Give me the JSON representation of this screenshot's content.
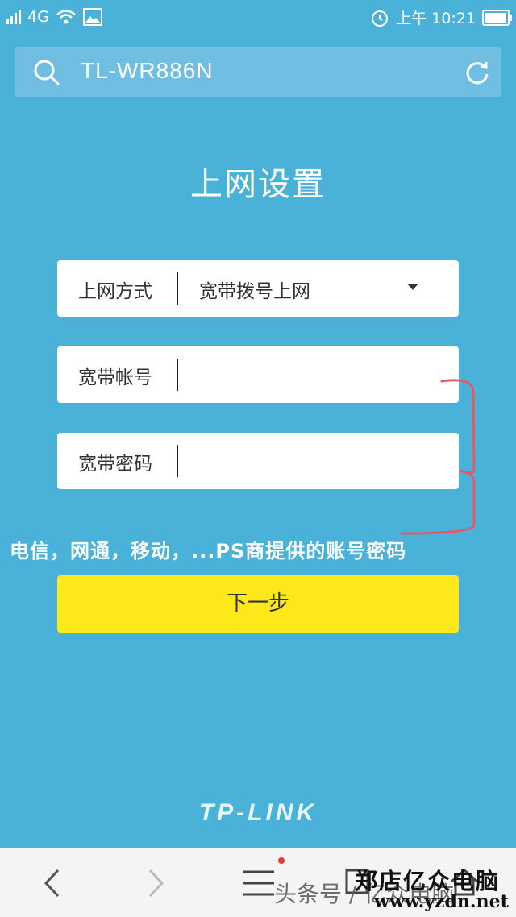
{
  "status_bar": {
    "network": "4G",
    "time": "上午 10:21"
  },
  "browser": {
    "address": "TL-WR886N"
  },
  "page": {
    "title": "上网设置",
    "fields": [
      {
        "label": "上网方式",
        "value": "宽带拨号上网"
      },
      {
        "label": "宽带帐号",
        "value": ""
      },
      {
        "label": "宽带密码",
        "value": ""
      }
    ],
    "annotation": "电信，网通，移动，...PS商提供的账号密码",
    "next_button": "下一步",
    "brand": "TP-LINK"
  },
  "watermarks": {
    "toutiao": "头条号 / 亿众电脑",
    "shop": "郑店亿众电脑",
    "url": "www.yzdn.net"
  },
  "colors": {
    "background": "#4ab1d9",
    "button": "#fde81a",
    "annotation_line": "#e05a6a"
  }
}
